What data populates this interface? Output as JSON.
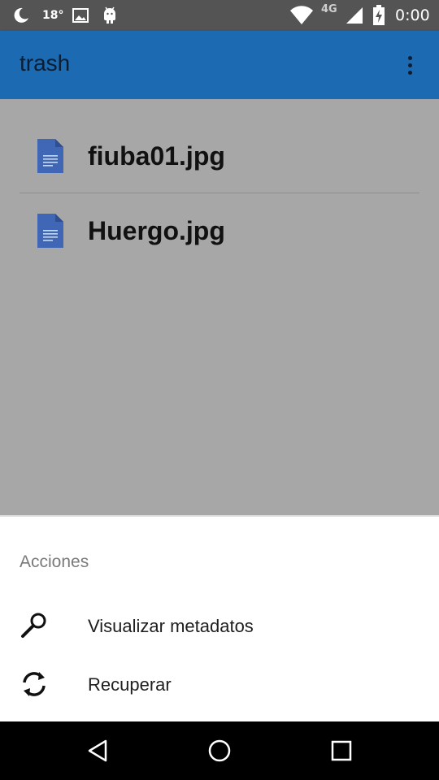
{
  "status_bar": {
    "icons": [
      "moon-icon",
      "image-icon",
      "android-icon",
      "wifi-icon",
      "signal-icon",
      "battery-charging-icon"
    ],
    "temperature": "18°",
    "network": "4G",
    "time": "0:00"
  },
  "app_bar": {
    "title": "trash",
    "menu_icon": "more-vert-icon"
  },
  "files": [
    {
      "name": "fiuba01.jpg",
      "icon": "document-icon"
    },
    {
      "name": "Huergo.jpg",
      "icon": "document-icon"
    }
  ],
  "sheet": {
    "title": "Acciones",
    "actions": [
      {
        "label": "Visualizar metadatos",
        "icon": "search-icon"
      },
      {
        "label": "Recuperar",
        "icon": "refresh-icon"
      }
    ]
  },
  "nav_bar": {
    "icons": [
      "back-icon",
      "home-icon",
      "recents-icon"
    ]
  },
  "colors": {
    "app_bar": "#1c6ab1",
    "status_bar": "#545454",
    "scrim": "#a7a7a7",
    "file_icon": "#3f67b6"
  }
}
